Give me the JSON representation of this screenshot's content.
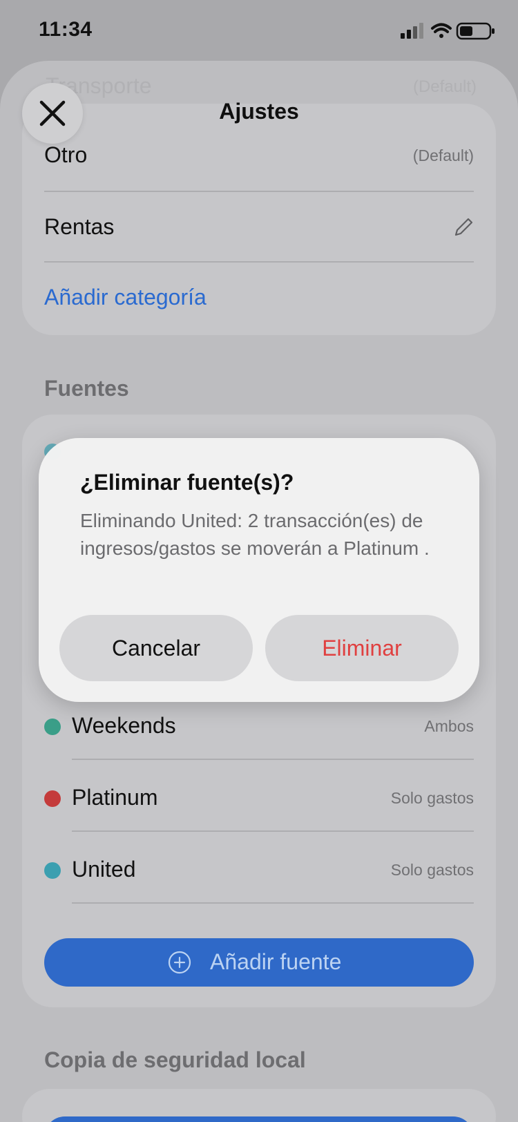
{
  "status": {
    "time": "11:34"
  },
  "header": {
    "title": "Ajustes",
    "ghost_row": "Transporte",
    "ghost_hint": "(Default)"
  },
  "categories": {
    "items": [
      {
        "label": "Otro",
        "hint": "(Default)"
      },
      {
        "label": "Rentas"
      }
    ],
    "add_label": "Añadir categoría"
  },
  "sources": {
    "section_title": "Fuentes",
    "items": [
      {
        "label": "Weekends",
        "type": "Ambos",
        "color": "#3a9e88"
      },
      {
        "label": "Platinum",
        "type": "Solo gastos",
        "color": "#c43b3b"
      },
      {
        "label": "United",
        "type": "Solo gastos",
        "color": "#3b9fb0"
      }
    ],
    "add_label": "Añadir fuente"
  },
  "backup": {
    "section_title": "Copia de seguridad local"
  },
  "dialog": {
    "title": "¿Eliminar fuente(s)?",
    "message": "Eliminando United: 2 transacción(es) de ingresos/gastos se moverán a Platinum .",
    "cancel_label": "Cancelar",
    "delete_label": "Eliminar"
  }
}
